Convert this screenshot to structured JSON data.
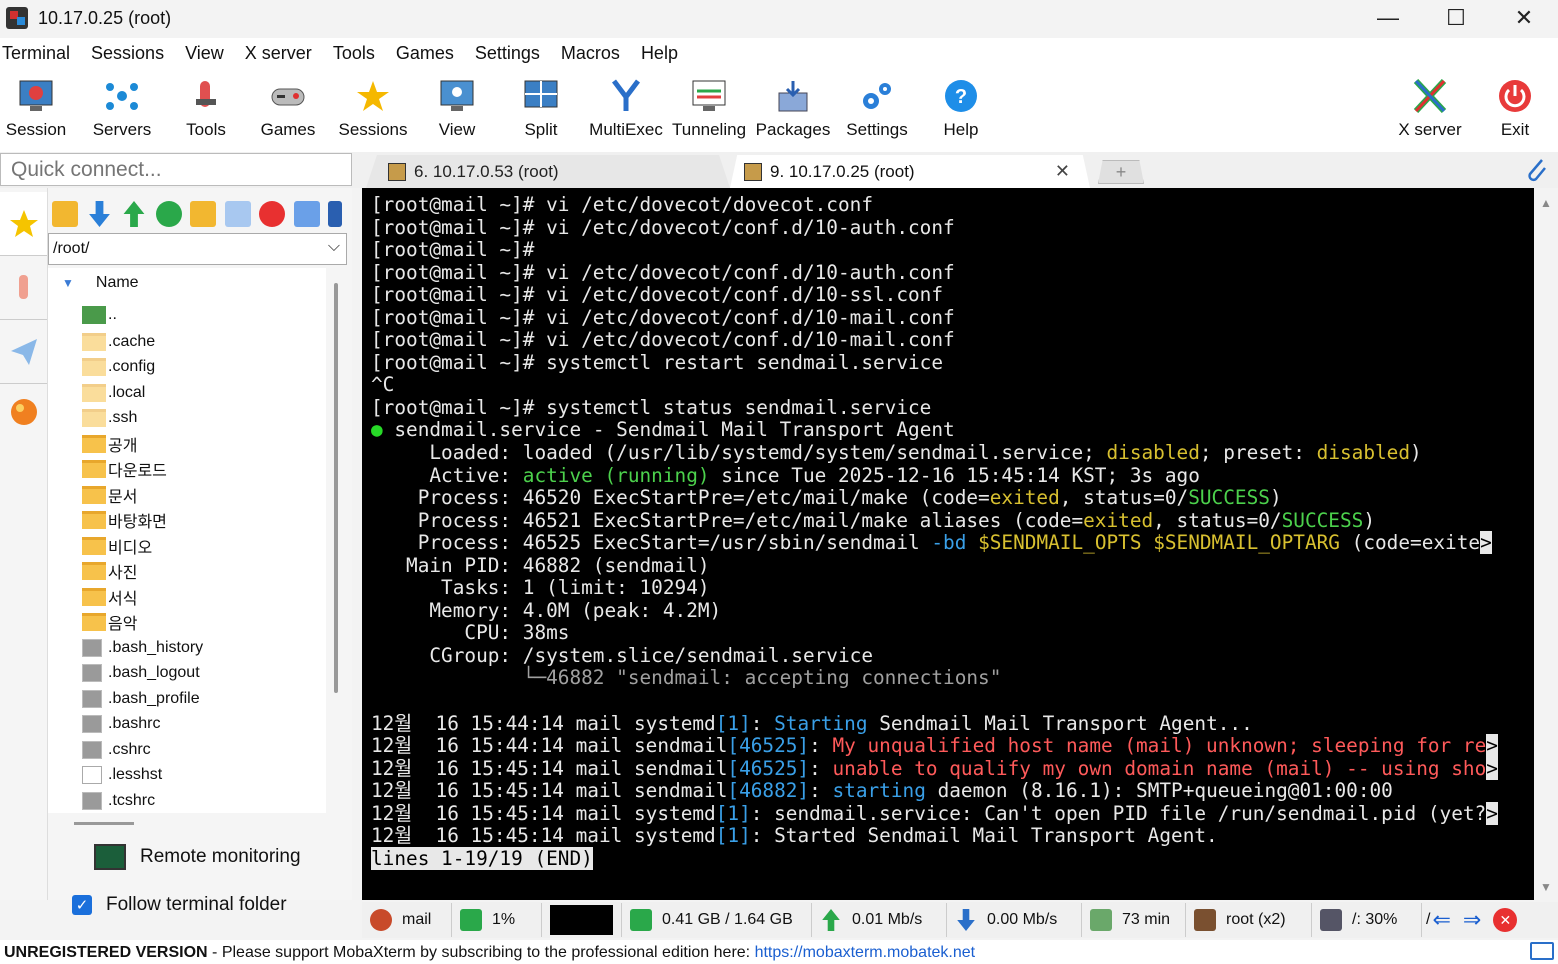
{
  "window": {
    "title": "10.17.0.25 (root)",
    "minimize": "—",
    "maximize": "☐",
    "close": "✕"
  },
  "menu": [
    "Terminal",
    "Sessions",
    "View",
    "X server",
    "Tools",
    "Games",
    "Settings",
    "Macros",
    "Help"
  ],
  "toolbar": [
    {
      "label": "Session",
      "icon": "session-icon"
    },
    {
      "label": "Servers",
      "icon": "servers-icon"
    },
    {
      "label": "Tools",
      "icon": "tools-icon"
    },
    {
      "label": "Games",
      "icon": "games-icon"
    },
    {
      "label": "Sessions",
      "icon": "star-icon"
    },
    {
      "label": "View",
      "icon": "view-icon"
    },
    {
      "label": "Split",
      "icon": "split-icon"
    },
    {
      "label": "MultiExec",
      "icon": "multiexec-icon"
    },
    {
      "label": "Tunneling",
      "icon": "tunneling-icon"
    },
    {
      "label": "Packages",
      "icon": "packages-icon"
    },
    {
      "label": "Settings",
      "icon": "settings-icon"
    },
    {
      "label": "Help",
      "icon": "help-icon"
    },
    {
      "label": "X server",
      "icon": "xserver-icon"
    },
    {
      "label": "Exit",
      "icon": "exit-icon"
    }
  ],
  "quick_connect": {
    "placeholder": "Quick connect..."
  },
  "tabs": [
    {
      "label": "6. 10.17.0.53 (root)",
      "active": false
    },
    {
      "label": "9. 10.17.0.25 (root)",
      "active": true
    }
  ],
  "sftp": {
    "path": "/root/",
    "column_name": "Name",
    "files": [
      {
        "name": "..",
        "type": "up"
      },
      {
        "name": ".cache",
        "type": "folder-light"
      },
      {
        "name": ".config",
        "type": "folder-light"
      },
      {
        "name": ".local",
        "type": "folder-light"
      },
      {
        "name": ".ssh",
        "type": "folder-light"
      },
      {
        "name": "공개",
        "type": "folder"
      },
      {
        "name": "다운로드",
        "type": "folder"
      },
      {
        "name": "문서",
        "type": "folder"
      },
      {
        "name": "바탕화면",
        "type": "folder"
      },
      {
        "name": "비디오",
        "type": "folder"
      },
      {
        "name": "사진",
        "type": "folder"
      },
      {
        "name": "서식",
        "type": "folder"
      },
      {
        "name": "음악",
        "type": "folder"
      },
      {
        "name": ".bash_history",
        "type": "file"
      },
      {
        "name": ".bash_logout",
        "type": "file"
      },
      {
        "name": ".bash_profile",
        "type": "file"
      },
      {
        "name": ".bashrc",
        "type": "file"
      },
      {
        "name": ".cshrc",
        "type": "file"
      },
      {
        "name": ".lesshst",
        "type": "file-light"
      },
      {
        "name": ".tcshrc",
        "type": "file"
      }
    ],
    "remote_monitoring": "Remote monitoring",
    "follow_terminal_folder": "Follow terminal folder",
    "follow_checked": true
  },
  "terminal": {
    "lines": [
      [
        {
          "t": "[root@mail ~]# vi /etc/dovecot/dovecot.conf"
        }
      ],
      [
        {
          "t": "[root@mail ~]# vi /etc/dovecot/conf.d/10-auth.conf"
        }
      ],
      [
        {
          "t": "[root@mail ~]#"
        }
      ],
      [
        {
          "t": "[root@mail ~]# vi /etc/dovecot/conf.d/10-auth.conf"
        }
      ],
      [
        {
          "t": "[root@mail ~]# vi /etc/dovecot/conf.d/10-ssl.conf"
        }
      ],
      [
        {
          "t": "[root@mail ~]# vi /etc/dovecot/conf.d/10-mail.conf"
        }
      ],
      [
        {
          "t": "[root@mail ~]# vi /etc/dovecot/conf.d/10-mail.conf"
        }
      ],
      [
        {
          "t": "[root@mail ~]# systemctl restart sendmail.service"
        }
      ],
      [
        {
          "t": "^C"
        }
      ],
      [
        {
          "t": "[root@mail ~]# systemctl status sendmail.service"
        }
      ],
      [
        {
          "t": "●",
          "c": "dot"
        },
        {
          "t": " sendmail.service - Sendmail Mail Transport Agent"
        }
      ],
      [
        {
          "t": "     Loaded: loaded (/usr/lib/systemd/system/sendmail.service; "
        },
        {
          "t": "disabled",
          "c": "y"
        },
        {
          "t": "; preset: "
        },
        {
          "t": "disabled",
          "c": "y"
        },
        {
          "t": ")"
        }
      ],
      [
        {
          "t": "     Active: "
        },
        {
          "t": "active (running)",
          "c": "g"
        },
        {
          "t": " since Tue 2025-12-16 15:45:14 KST; 3s ago"
        }
      ],
      [
        {
          "t": "    Process: 46520 ExecStartPre=/etc/mail/make (code="
        },
        {
          "t": "exited",
          "c": "y"
        },
        {
          "t": ", status=0/"
        },
        {
          "t": "SUCCESS",
          "c": "g"
        },
        {
          "t": ")"
        }
      ],
      [
        {
          "t": "    Process: 46521 ExecStartPre=/etc/mail/make aliases (code="
        },
        {
          "t": "exited",
          "c": "y"
        },
        {
          "t": ", status=0/"
        },
        {
          "t": "SUCCESS",
          "c": "g"
        },
        {
          "t": ")"
        }
      ],
      [
        {
          "t": "    Process: 46525 ExecStart=/usr/sbin/sendmail "
        },
        {
          "t": "-bd",
          "c": "c"
        },
        {
          "t": " "
        },
        {
          "t": "$SENDMAIL_OPTS $SENDMAIL_OPTARG",
          "c": "y"
        },
        {
          "t": " (code=exite"
        },
        {
          "t": ">",
          "c": "inv"
        }
      ],
      [
        {
          "t": "   Main PID: 46882 (sendmail)"
        }
      ],
      [
        {
          "t": "      Tasks: 1 (limit: 10294)"
        }
      ],
      [
        {
          "t": "     Memory: 4.0M (peak: 4.2M)"
        }
      ],
      [
        {
          "t": "        CPU: 38ms"
        }
      ],
      [
        {
          "t": "     CGroup: /system.slice/sendmail.service"
        }
      ],
      [
        {
          "t": "             "
        },
        {
          "t": "└─46882 \"sendmail: accepting connections\"",
          "c": "dim"
        }
      ],
      [
        {
          "t": ""
        }
      ],
      [
        {
          "t": "12월  16 15:44:14 mail systemd"
        },
        {
          "t": "[1]",
          "c": "c"
        },
        {
          "t": ": "
        },
        {
          "t": "Starting",
          "c": "c"
        },
        {
          "t": " Sendmail Mail Transport Agent..."
        }
      ],
      [
        {
          "t": "12월  16 15:44:14 mail sendmail"
        },
        {
          "t": "[46525]",
          "c": "c"
        },
        {
          "t": ": "
        },
        {
          "t": "My unqualified host name (mail) unknown; sleeping for re",
          "c": "r"
        },
        {
          "t": ">",
          "c": "inv"
        }
      ],
      [
        {
          "t": "12월  16 15:45:14 mail sendmail"
        },
        {
          "t": "[46525]",
          "c": "c"
        },
        {
          "t": ": "
        },
        {
          "t": "unable to qualify my own domain name (mail) -- using sho",
          "c": "r"
        },
        {
          "t": ">",
          "c": "inv"
        }
      ],
      [
        {
          "t": "12월  16 15:45:14 mail sendmail"
        },
        {
          "t": "[46882]",
          "c": "c"
        },
        {
          "t": ": "
        },
        {
          "t": "starting",
          "c": "c"
        },
        {
          "t": " daemon (8.16.1): SMTP+queueing@01:00:00"
        }
      ],
      [
        {
          "t": "12월  16 15:45:14 mail systemd"
        },
        {
          "t": "[1]",
          "c": "c"
        },
        {
          "t": ": sendmail.service: Can't open PID file /run/sendmail.pid (yet?"
        },
        {
          "t": ">",
          "c": "inv"
        }
      ],
      [
        {
          "t": "12월  16 15:45:14 mail systemd"
        },
        {
          "t": "[1]",
          "c": "c"
        },
        {
          "t": ": Started Sendmail Mail Transport Agent."
        }
      ],
      [
        {
          "t": "lines 1-19/19 (END)",
          "c": "inv"
        }
      ]
    ]
  },
  "statusbar": {
    "host": "mail",
    "cpu": "1%",
    "memory": "0.41 GB / 1.64 GB",
    "upload": "0.01 Mb/s",
    "download": "0.00 Mb/s",
    "uptime": "73 min",
    "users": "root (x2)",
    "disk": "/: 30%",
    "disk_more": "/"
  },
  "footer": {
    "unregistered": "UNREGISTERED VERSION",
    "message": "  -  Please support MobaXterm by subscribing to the professional edition here: ",
    "link": "https://mobaxterm.mobatek.net"
  }
}
